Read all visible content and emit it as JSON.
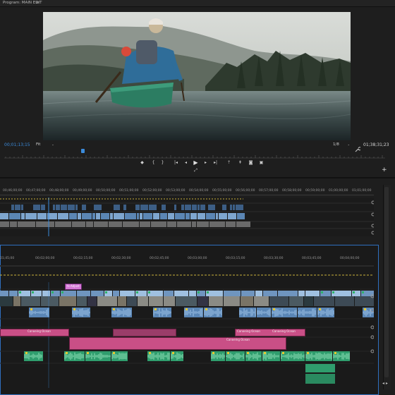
{
  "monitor": {
    "title": "Program: MAIN EDIT",
    "menu_icon": "hamburger-icon",
    "timecode_current": "00;01;13;15",
    "fit": "Fit",
    "resolution": "1/8",
    "timecode_duration": "01;38;31;23"
  },
  "transport": {
    "buttons": [
      "marker-icon",
      "in-point-icon",
      "out-point-icon",
      "go-to-in-icon",
      "step-back-icon",
      "play-icon",
      "step-forward-icon",
      "go-to-out-icon",
      "lift-icon",
      "extract-icon",
      "export-frame-icon",
      "compare-icon"
    ]
  },
  "sync_ruler": {
    "ticks": [
      "00;46;00;00",
      "00;47;00;00",
      "00;48;00;00",
      "00;49;00;00",
      "00;50;00;00",
      "00;51;00;00",
      "00;52;00;00",
      "00;53;00;00",
      "00;54;00;00",
      "00;55;00;00",
      "00;56;00;00",
      "00;57;00;00",
      "00;58;00;00",
      "00;59;00;00",
      "01;00;00;00",
      "01;01;00;00"
    ]
  },
  "timeline_ruler": {
    "ticks": [
      "01;45;00",
      "00;02;00;00",
      "00;02;15;00",
      "00;02;30;00",
      "00;02;45;00",
      "00;03;00;00",
      "00;03;15;00",
      "00;03;30;00",
      "00;03;45;00",
      "00;04;00;00"
    ]
  },
  "clips": {
    "adjustment": "fx Adjust",
    "music_a": "Canoeing Ocean",
    "music_b": "Canoeing Ocean",
    "music_c": "Canoeing Ocean",
    "music_d": "Canoeing Ocean"
  },
  "colors": {
    "accent": "#3b8bdb",
    "video_clip": "#8cb3d9",
    "audio_clip": "#5a86b6",
    "music_clip": "#c94f86",
    "sfx_clip": "#2f9d6d",
    "adjustment_clip": "#d67ad8"
  },
  "bottom_nav": "◂ ▸"
}
